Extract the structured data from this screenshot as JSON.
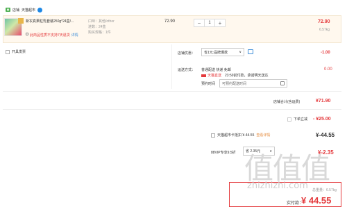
{
  "shop": {
    "label": "店铺",
    "name": "天猫超市"
  },
  "item": {
    "title": "新农真果粒乳套装250g*24盒/...",
    "props": [
      "口味：其他/other",
      "进数：24盒",
      "购买规格：1件"
    ],
    "note": "此商品性质不支持7天退货",
    "note_link": "详情",
    "unit_price": "72.90",
    "quantity": "1",
    "minus": "−",
    "plus": "+",
    "total": "72.90",
    "weight": "6.57kg"
  },
  "invoice": {
    "label": "开具发票"
  },
  "promo": {
    "label": "店铺优惠：",
    "value": "省1元:品牌爆款",
    "amount": "-1.00"
  },
  "delivery": {
    "label": "运送方式：",
    "method": "普通配送 快递 免邮",
    "tag": "天猫直送",
    "eta": "23:59前付款，承诺明天送达",
    "time_label": "预约时间",
    "time_placeholder": "可预约配送时间",
    "amount": "0.00"
  },
  "shop_total": {
    "label": "店铺合计(含运费)",
    "value": "¥71.90"
  },
  "order_discount": {
    "label": "下单立减",
    "value": "- ¥25.00"
  },
  "card_offer": {
    "label": "天猫超市卡抵扣 ¥-44.55",
    "link": "查看详情",
    "value": "¥-44.55"
  },
  "vip": {
    "label": "88VIP专享9.5折",
    "select": "省 2.35元",
    "value": "¥-2.35"
  },
  "summary": {
    "weight": "总重量：6.57kg",
    "paid_label": "实付款：",
    "paid_value": "¥ 44.55"
  },
  "watermark": {
    "glyphs": "值值值",
    "url": "zhizhizhi.com"
  },
  "colors": {
    "accent": "#e4393c",
    "card_bg": "#fff8ee",
    "delivery_tag": "#e4393c",
    "tmall_blue": "#1e88e5"
  }
}
